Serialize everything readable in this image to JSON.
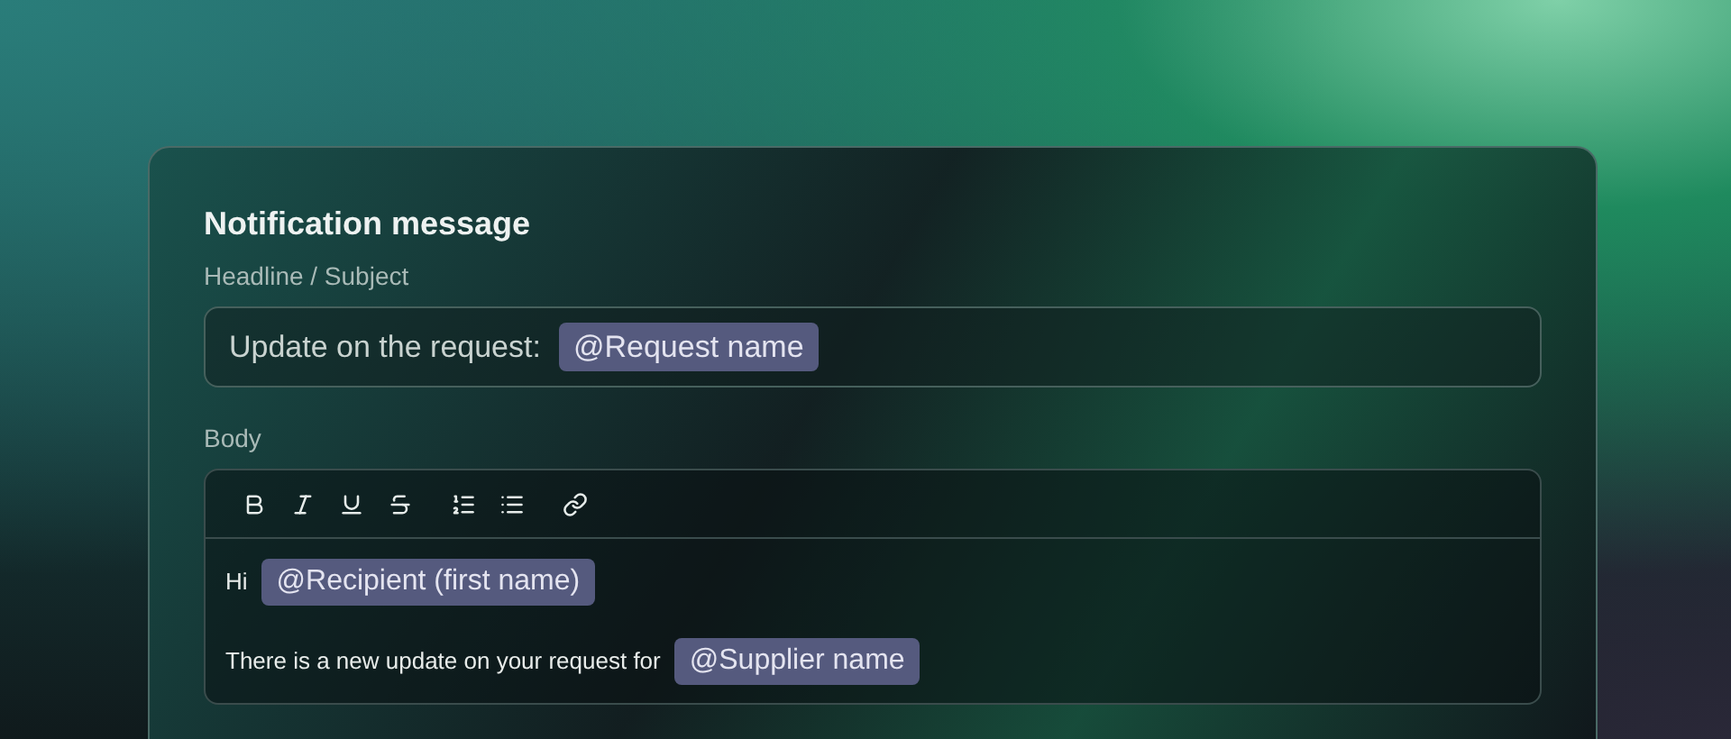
{
  "card": {
    "title": "Notification message"
  },
  "subject": {
    "label": "Headline / Subject",
    "segments": [
      {
        "kind": "text",
        "text": "Update on the request:"
      },
      {
        "kind": "mention",
        "text": "@Request name"
      }
    ]
  },
  "body": {
    "label": "Body",
    "toolbar": [
      {
        "kind": "bold"
      },
      {
        "kind": "italic"
      },
      {
        "kind": "underline"
      },
      {
        "kind": "strikethrough"
      },
      {
        "kind": "ordered-list"
      },
      {
        "kind": "bullet-list"
      },
      {
        "kind": "link"
      }
    ],
    "lines": [
      {
        "segments": [
          {
            "kind": "text",
            "text": "Hi"
          },
          {
            "kind": "mention",
            "text": "@Recipient (first name)"
          }
        ]
      },
      {
        "segments": [
          {
            "kind": "text",
            "text": "There is a new update on your request for"
          },
          {
            "kind": "mention",
            "text": "@Supplier name"
          }
        ]
      }
    ]
  }
}
